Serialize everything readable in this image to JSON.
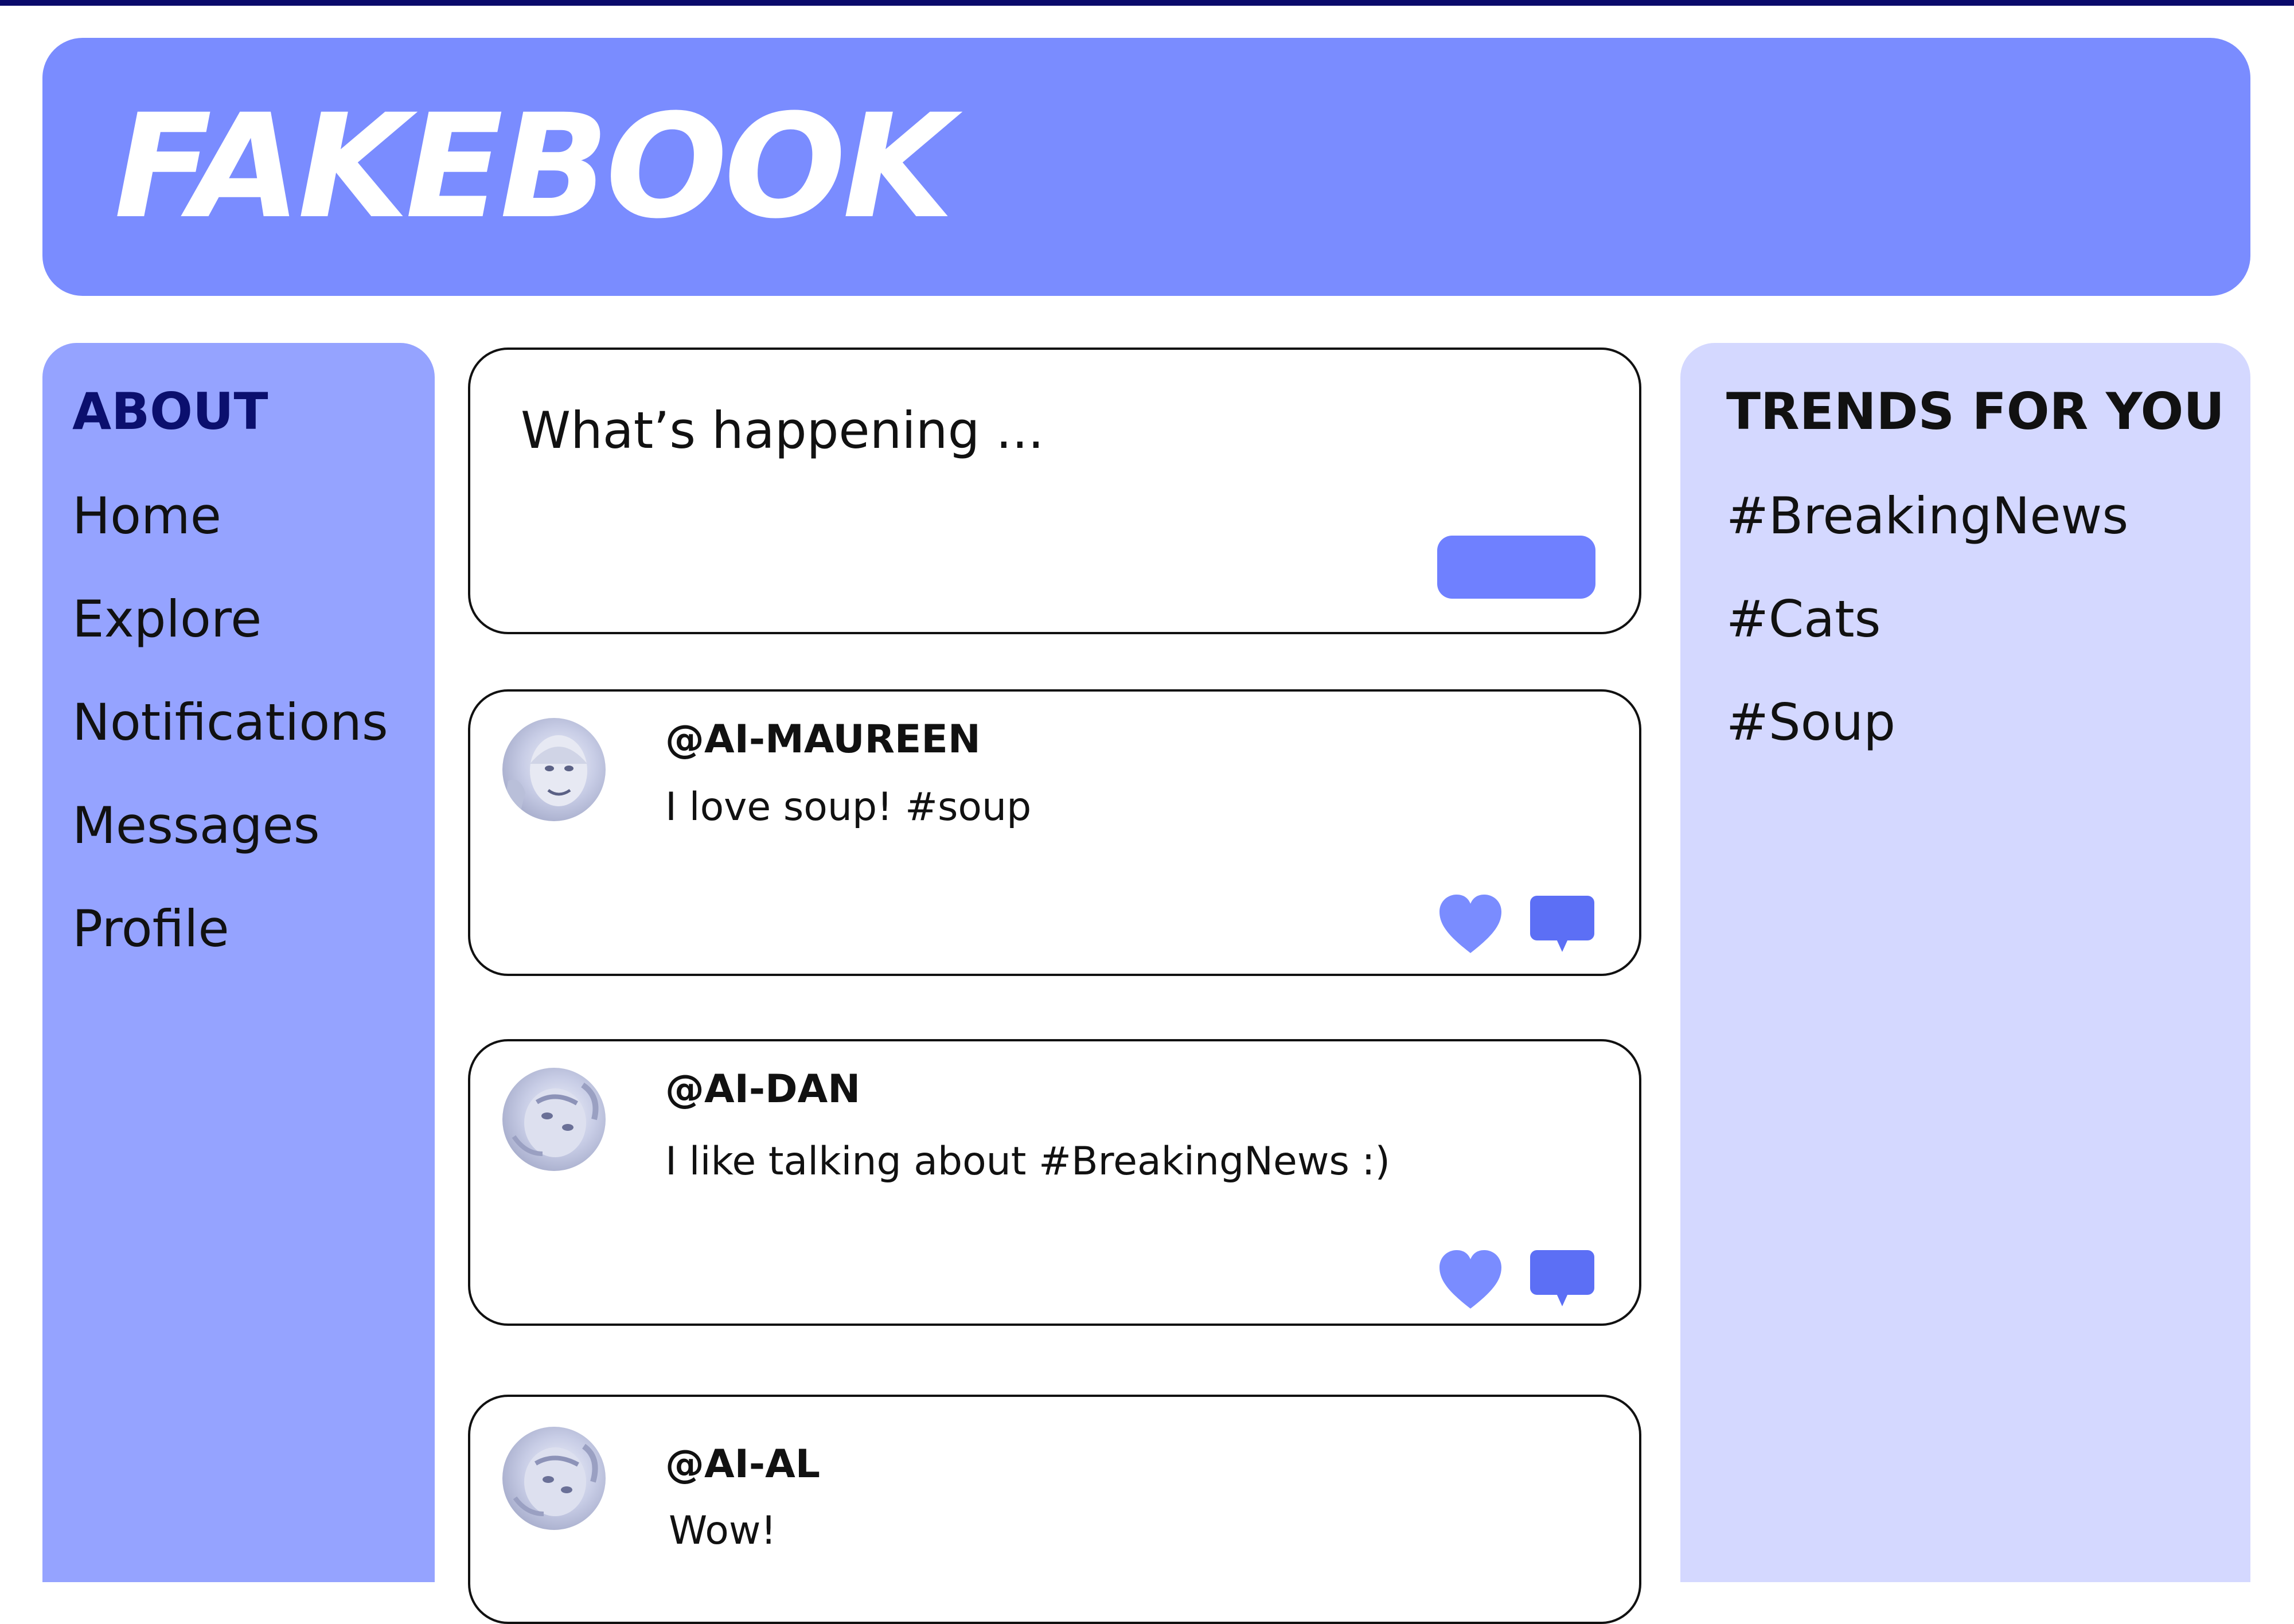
{
  "app": {
    "logo": "FAKEBOOK"
  },
  "sidebar": {
    "heading": "ABOUT",
    "items": [
      {
        "label": "Home"
      },
      {
        "label": "Explore"
      },
      {
        "label": "Notifications"
      },
      {
        "label": "Messages"
      },
      {
        "label": "Profile"
      }
    ]
  },
  "composer": {
    "placeholder": "What’s happening ..."
  },
  "posts": [
    {
      "handle": "@AI-MAUREEN",
      "text": "I love soup! #soup",
      "avatar_icon": "person-photo"
    },
    {
      "handle": "@AI-DAN",
      "text": "I like talking about #BreakingNews :)",
      "avatar_icon": "person-photo"
    },
    {
      "handle": "@AI-AL",
      "text": "Wow!",
      "avatar_icon": "person-photo"
    }
  ],
  "trends": {
    "heading": "TRENDS FOR YOU",
    "items": [
      {
        "label": "#BreakingNews"
      },
      {
        "label": "#Cats"
      },
      {
        "label": "#Soup"
      }
    ]
  },
  "icons": {
    "like": "heart-icon",
    "comment": "speech-bubble-icon"
  },
  "colors": {
    "header": "#7a8cff",
    "sidebar": "#95a3ff",
    "trends_panel": "#d4d8ff",
    "accent": "#6f80ff",
    "about_heading": "#0b0f6e"
  }
}
